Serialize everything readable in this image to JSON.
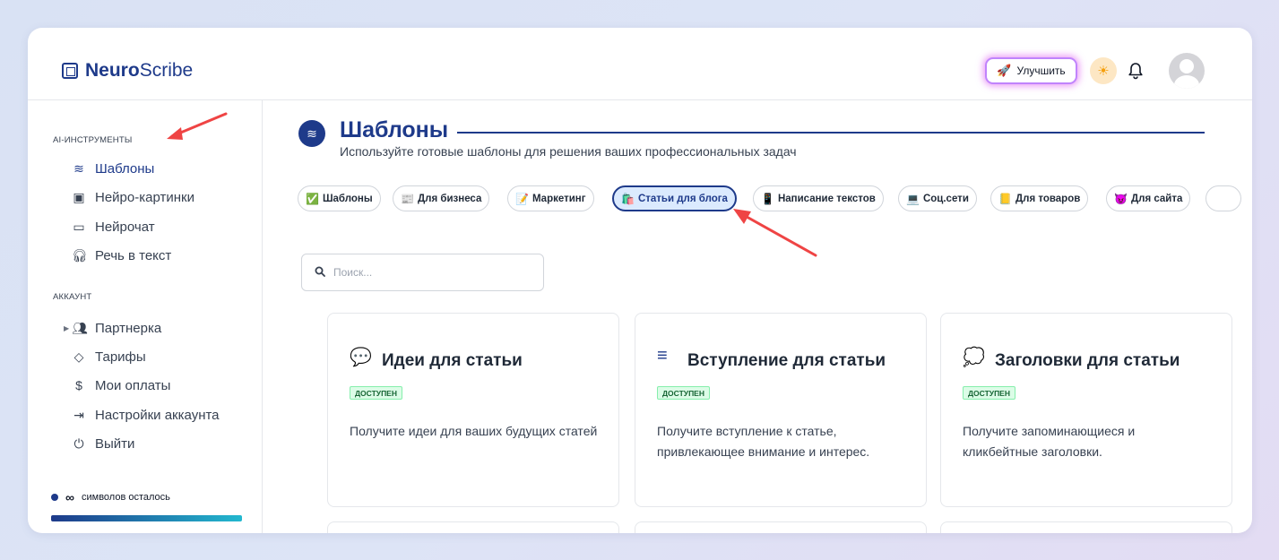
{
  "app": {
    "logo_bold": "Neuro",
    "logo_rest": "Scribe"
  },
  "header": {
    "upgrade_label": "Улучшить"
  },
  "sidebar": {
    "section_tools": "AI-ИНСТРУМЕНТЫ",
    "tools": [
      {
        "label": "Шаблоны",
        "icon": "layers-icon"
      },
      {
        "label": "Нейро-картинки",
        "icon": "image-icon"
      },
      {
        "label": "Нейрочат",
        "icon": "chat-icon"
      },
      {
        "label": "Речь в текст",
        "icon": "headphones-icon"
      }
    ],
    "section_account": "АККАУНТ",
    "account": [
      {
        "label": "Партнерка",
        "icon": "users-icon"
      },
      {
        "label": "Тарифы",
        "icon": "tag-icon"
      },
      {
        "label": "Мои оплаты",
        "icon": "dollar-icon"
      },
      {
        "label": "Настройки аккаунта",
        "icon": "login-icon"
      },
      {
        "label": "Выйти",
        "icon": "power-icon"
      }
    ],
    "symbols_value": "∞",
    "symbols_text": "символов осталось"
  },
  "main": {
    "title": "Шаблоны",
    "subtitle": "Используйте готовые шаблоны для решения ваших профессиональных задач",
    "chips": [
      {
        "emoji": "✅",
        "label": "Шаблоны"
      },
      {
        "emoji": "📰",
        "label": "Для бизнеса"
      },
      {
        "emoji": "📝",
        "label": "Маркетинг"
      },
      {
        "emoji": "🛍️",
        "label": "Статьи для блога",
        "active": true
      },
      {
        "emoji": "📱",
        "label": "Написание текстов"
      },
      {
        "emoji": "💻",
        "label": "Соц.сети"
      },
      {
        "emoji": "📒",
        "label": "Для товаров"
      },
      {
        "emoji": "😈",
        "label": "Для сайта"
      }
    ],
    "search_placeholder": "Поиск...",
    "cards": [
      {
        "icon": "💬",
        "title": "Идеи для статьи",
        "badge": "ДОСТУПЕН",
        "description": "Получите идеи для ваших будущих статей"
      },
      {
        "icon": "≡",
        "title": "Вступление для статьи",
        "badge": "ДОСТУПЕН",
        "description": "Получите вступление к статье, привлекающее внимание и интерес."
      },
      {
        "icon": "💭",
        "title": "Заголовки для статьи",
        "badge": "ДОСТУПЕН",
        "description": "Получите запоминающиеся и кликбейтные заголовки."
      }
    ]
  },
  "colors": {
    "brand": "#1e3a8a",
    "accent_cyan": "#22b8cf",
    "badge_green": "#dcfce7",
    "annotation_arrow": "#ef4444"
  }
}
